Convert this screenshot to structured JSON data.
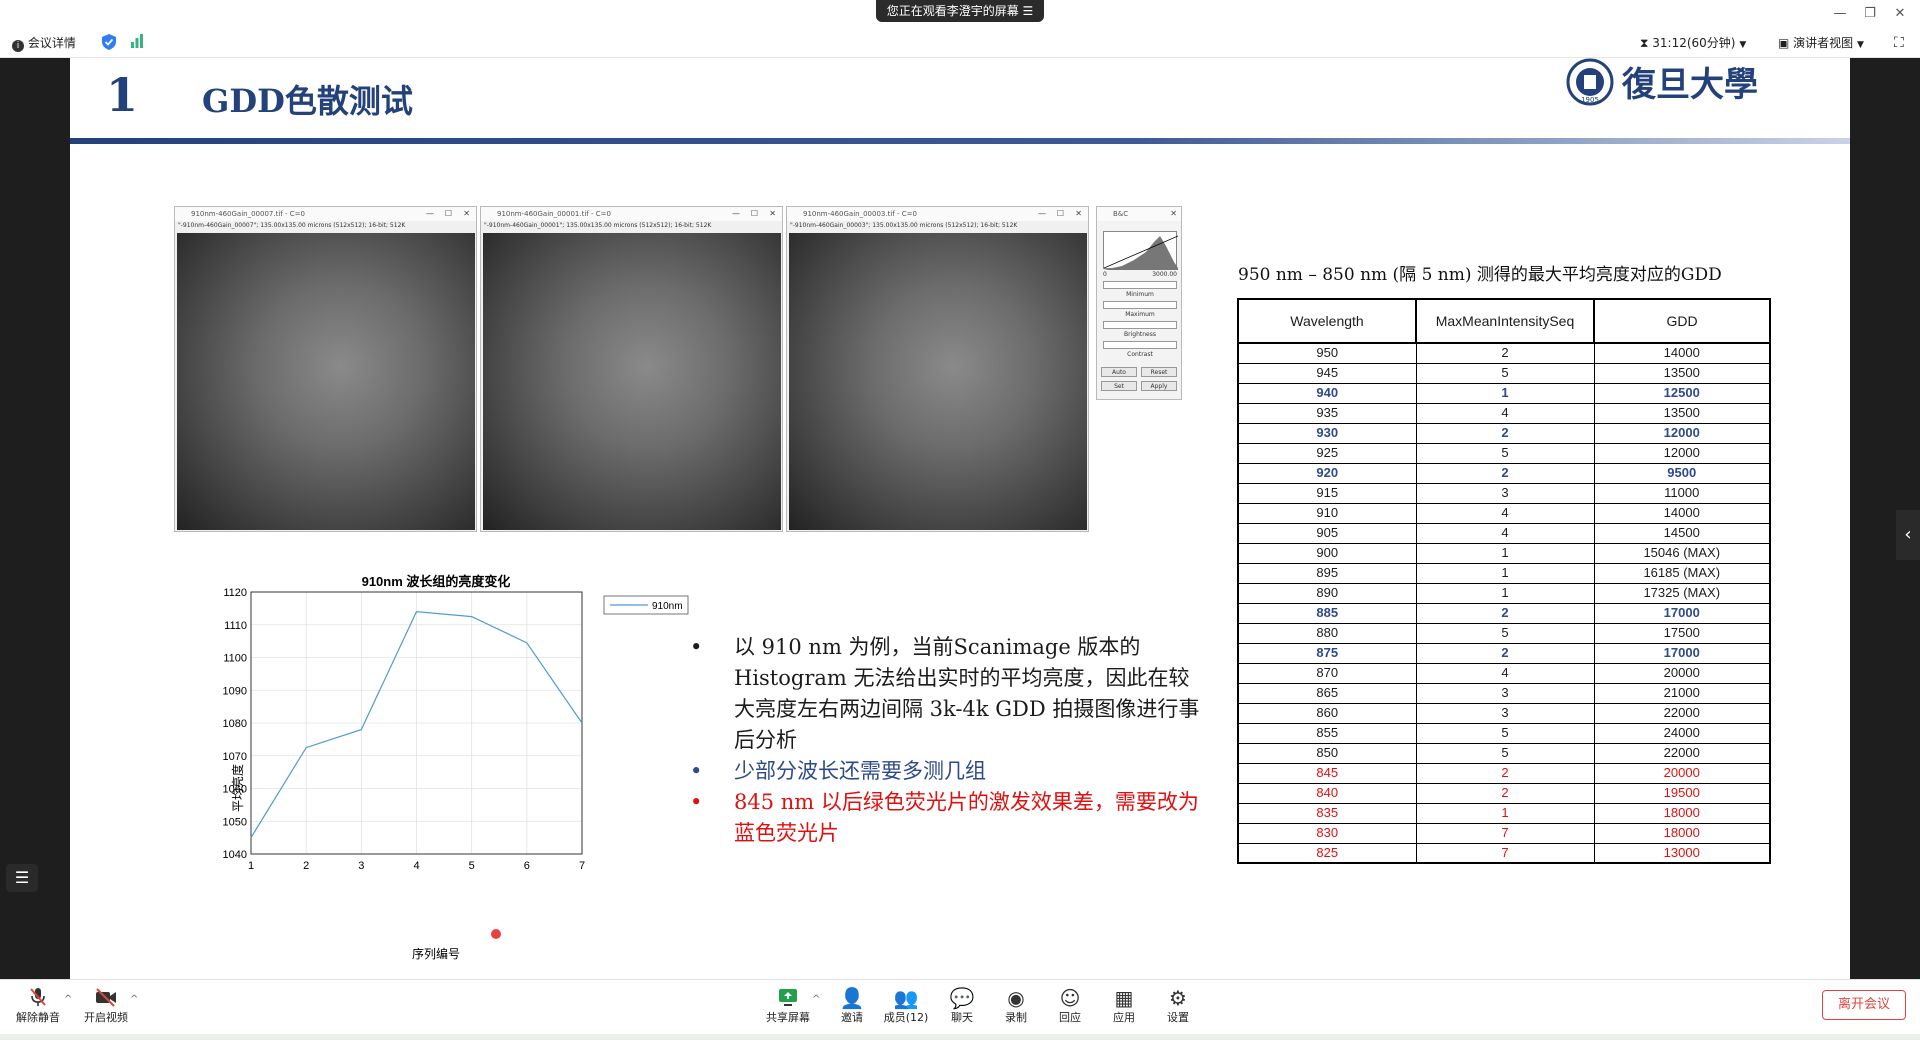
{
  "window": {
    "share_banner": "您正在观看李澄宇的屏幕 ☰",
    "minimize": "—",
    "restore": "❐",
    "close": "✕"
  },
  "infobar": {
    "meeting_info": "会议详情",
    "timer": "31:12(60分钟)",
    "view_mode": "演讲者视图"
  },
  "slide": {
    "number": "1",
    "title": "GDD色散测试",
    "logo_text": "復旦大學",
    "logo_year": "1905"
  },
  "imagej": {
    "windows": [
      {
        "title": "910nm-460Gain_00007.tif - C=0",
        "info": "\"-910nm-460Gain_00007\"; 135.00x135.00 microns (512x512); 16-bit; 512K"
      },
      {
        "title": "910nm-460Gain_00001.tif - C=0",
        "info": "\"-910nm-460Gain_00001\"; 135.00x135.00 microns (512x512); 16-bit; 512K"
      },
      {
        "title": "910nm-460Gain_00003.tif - C=0",
        "info": "\"-910nm-460Gain_00003\"; 135.00x135.00 microns (512x512); 16-bit; 512K"
      }
    ],
    "bc": {
      "title": "B&C",
      "range_min": "0",
      "range_max": "3000.00",
      "minimum": "Minimum",
      "maximum": "Maximum",
      "brightness": "Brightness",
      "contrast": "Contrast",
      "auto": "Auto",
      "reset": "Reset",
      "set": "Set",
      "apply": "Apply"
    }
  },
  "chart_data": {
    "type": "line",
    "title": "910nm 波长组的亮度变化",
    "xlabel": "序列编号",
    "ylabel": "平均亮度",
    "x": [
      1,
      2,
      3,
      4,
      5,
      6,
      7
    ],
    "series": [
      {
        "name": "910nm",
        "values": [
          1045,
          1072.5,
          1078,
          1114,
          1112.5,
          1104.5,
          1080
        ],
        "color": "#4f9bd4"
      }
    ],
    "xlim": [
      1,
      7
    ],
    "ylim": [
      1040,
      1120
    ],
    "xticks": [
      "1",
      "2",
      "3",
      "4",
      "5",
      "6",
      "7"
    ],
    "yticks": [
      "1040",
      "1050",
      "1060",
      "1070",
      "1080",
      "1090",
      "1100",
      "1110",
      "1120"
    ],
    "grid": true,
    "legend": "top-right"
  },
  "bullets": [
    {
      "text": "以 910 nm 为例，当前Scanimage 版本的Histogram 无法给出实时的平均亮度，因此在较大亮度左右两边间隔 3k-4k GDD 拍摄图像进行事后分析"
    },
    {
      "text": "少部分波长还需要多测几组"
    },
    {
      "text": "845 nm 以后绿色荧光片的激发效果差，需要改为蓝色荧光片"
    }
  ],
  "table": {
    "caption": "950 nm – 850 nm (隔 5 nm) 测得的最大平均亮度对应的GDD",
    "headers": [
      "Wavelength",
      "MaxMeanIntensitySeq",
      "GDD"
    ],
    "rows": [
      {
        "cells": [
          "950",
          "2",
          "14000"
        ],
        "style": ""
      },
      {
        "cells": [
          "945",
          "5",
          "13500"
        ],
        "style": ""
      },
      {
        "cells": [
          "940",
          "1",
          "12500"
        ],
        "style": "blue"
      },
      {
        "cells": [
          "935",
          "4",
          "13500"
        ],
        "style": ""
      },
      {
        "cells": [
          "930",
          "2",
          "12000"
        ],
        "style": "blue"
      },
      {
        "cells": [
          "925",
          "5",
          "12000"
        ],
        "style": ""
      },
      {
        "cells": [
          "920",
          "2",
          "9500"
        ],
        "style": "blue"
      },
      {
        "cells": [
          "915",
          "3",
          "11000"
        ],
        "style": ""
      },
      {
        "cells": [
          "910",
          "4",
          "14000"
        ],
        "style": ""
      },
      {
        "cells": [
          "905",
          "4",
          "14500"
        ],
        "style": ""
      },
      {
        "cells": [
          "900",
          "1",
          "15046 (MAX)"
        ],
        "style": ""
      },
      {
        "cells": [
          "895",
          "1",
          "16185 (MAX)"
        ],
        "style": ""
      },
      {
        "cells": [
          "890",
          "1",
          "17325 (MAX)"
        ],
        "style": ""
      },
      {
        "cells": [
          "885",
          "2",
          "17000"
        ],
        "style": "blue"
      },
      {
        "cells": [
          "880",
          "5",
          "17500"
        ],
        "style": ""
      },
      {
        "cells": [
          "875",
          "2",
          "17000"
        ],
        "style": "blue"
      },
      {
        "cells": [
          "870",
          "4",
          "20000"
        ],
        "style": ""
      },
      {
        "cells": [
          "865",
          "3",
          "21000"
        ],
        "style": ""
      },
      {
        "cells": [
          "860",
          "3",
          "22000"
        ],
        "style": ""
      },
      {
        "cells": [
          "855",
          "5",
          "24000"
        ],
        "style": ""
      },
      {
        "cells": [
          "850",
          "5",
          "22000"
        ],
        "style": ""
      },
      {
        "cells": [
          "845",
          "2",
          "20000"
        ],
        "style": "red"
      },
      {
        "cells": [
          "840",
          "2",
          "19500"
        ],
        "style": "red"
      },
      {
        "cells": [
          "835",
          "1",
          "18000"
        ],
        "style": "red"
      },
      {
        "cells": [
          "830",
          "7",
          "18000"
        ],
        "style": "red"
      },
      {
        "cells": [
          "825",
          "7",
          "13000"
        ],
        "style": "red"
      }
    ]
  },
  "toolbar": {
    "unmute": "解除静音",
    "start_video": "开启视频",
    "share_screen": "共享屏幕",
    "invite": "邀请",
    "members": "成员(12)",
    "chat": "聊天",
    "record": "录制",
    "reactions": "回应",
    "apps": "应用",
    "settings": "设置",
    "leave": "离开会议"
  },
  "colors": {
    "title_blue": "#23417a",
    "highlight_blue": "#2e4a8a",
    "alert_red": "#e01010",
    "leave_red": "#e0443e",
    "series_blue": "#4f9bd4"
  }
}
